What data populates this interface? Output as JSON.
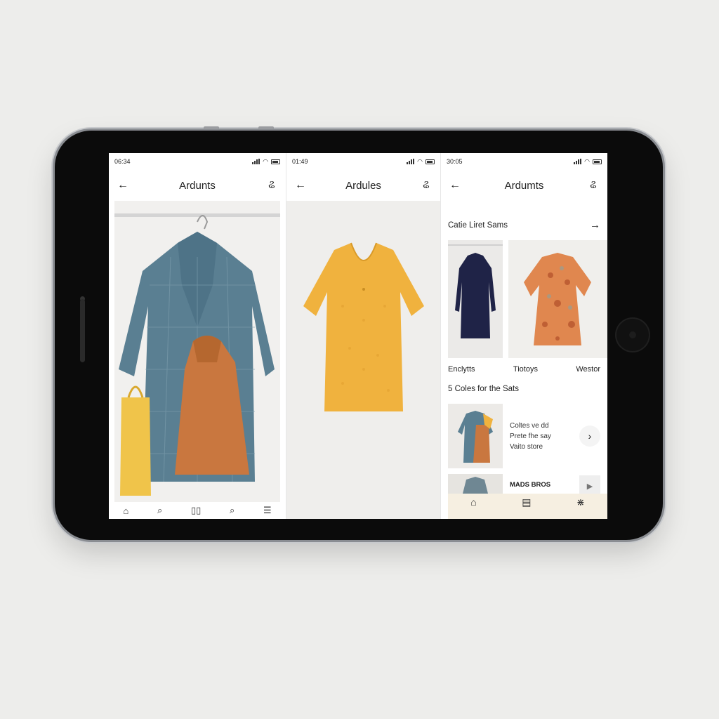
{
  "screens": [
    {
      "status_time": "06:34",
      "back_icon": "arrow-left-icon",
      "title": "Ardunts",
      "action_icon": "squiggle-icon",
      "bottom_nav": [
        "home-icon",
        "search-icon",
        "book-icon",
        "search-icon",
        "menu-icon"
      ]
    },
    {
      "status_time": "01:49",
      "back_icon": "arrow-left-icon",
      "title": "Ardules",
      "action_icon": "squiggle-icon"
    },
    {
      "status_time": "30:05",
      "back_icon": "arrow-left-icon",
      "title": "Ardumts",
      "action_icon": "squiggle-icon",
      "section1_title": "Catie Liret Sams",
      "categories": [
        "Enclytts",
        "Tiotoys",
        "Westor"
      ],
      "section2_title": "5 Coles for the Sats",
      "list_item_lines": [
        "Coltes ve dd",
        "Prete fhe say",
        "Vaito store"
      ],
      "list_item2_label": "MADS BROS",
      "tabs": [
        "home-icon",
        "layout-icon",
        "spark-icon"
      ]
    }
  ],
  "colors": {
    "denim": "#5a7f92",
    "rust": "#c9773f",
    "mustard": "#f0b23e",
    "navy": "#1f2347",
    "floral": "#e0874f",
    "tab_bg": "#f6efe1"
  }
}
